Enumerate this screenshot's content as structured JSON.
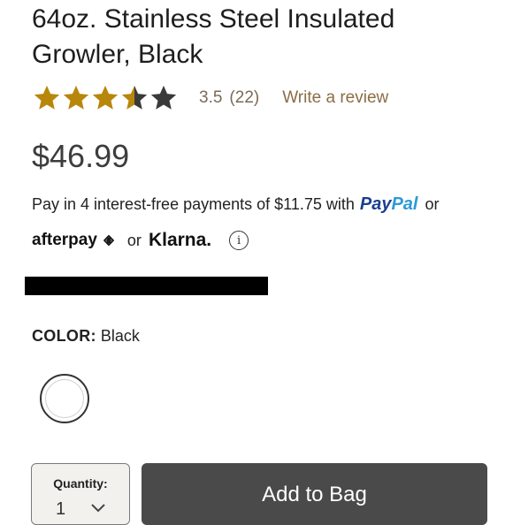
{
  "product": {
    "title": "64oz. Stainless Steel Insulated Growler, Black",
    "rating": {
      "value": "3.5",
      "count": "(22)",
      "stars_filled": 3.5,
      "stars_total": 5,
      "write_review_label": "Write a review"
    },
    "price": "$46.99"
  },
  "payment": {
    "line1_text": "Pay in 4 interest-free payments of $11.75 with",
    "paypal_part1": "Pay",
    "paypal_part2": "Pal",
    "or_text": "or",
    "afterpay_label": "afterpay",
    "or_text2": "or",
    "klarna_label": "Klarna.",
    "info_icon": "i"
  },
  "color": {
    "label": "COLOR:",
    "value": "Black"
  },
  "purchase": {
    "quantity_label": "Quantity:",
    "quantity_value": "1",
    "add_to_bag_label": "Add to Bag"
  },
  "colors": {
    "star_gold": "#b8860b",
    "star_gray": "#3a3a3a",
    "link_brown": "#8a6d43",
    "paypal_dark": "#1b3f8f",
    "paypal_light": "#2d9ad8",
    "button_bg": "#4a4a4a"
  }
}
